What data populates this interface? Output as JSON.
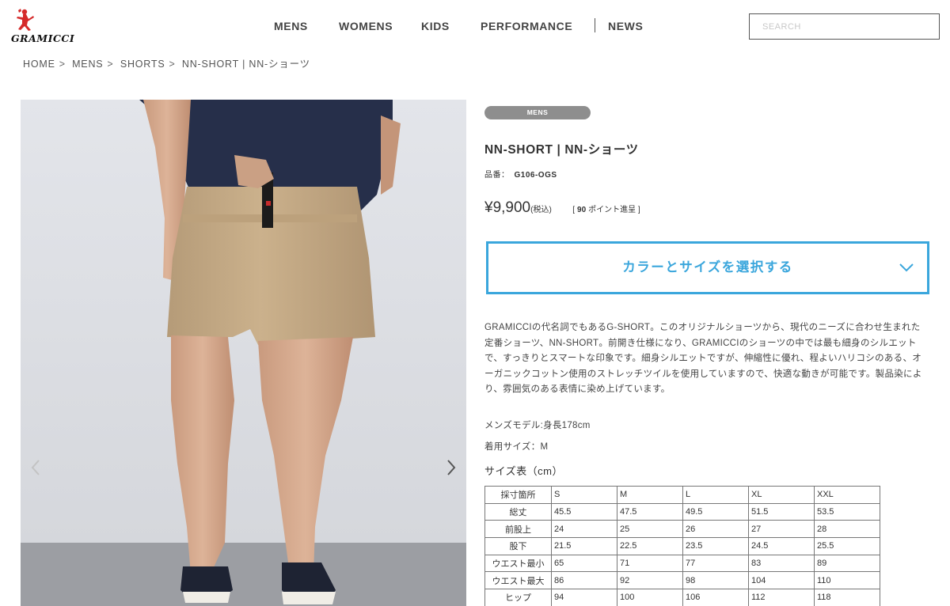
{
  "brand": {
    "logo_text": "GRAMICCI",
    "logo_color": "#d52a2a"
  },
  "nav": {
    "items": [
      "MENS",
      "WOMENS",
      "KIDS",
      "PERFORMANCE",
      "NEWS"
    ]
  },
  "search": {
    "placeholder": "SEARCH"
  },
  "breadcrumb": [
    "HOME",
    "MENS",
    "SHORTS",
    "NN-SHORT | NN-ショーツ"
  ],
  "product": {
    "category_badge": "MENS",
    "title": "NN-SHORT | NN-ショーツ",
    "sku_label": "品番：",
    "sku": "G106-OGS",
    "price": "¥9,900",
    "tax_label": "(税込)",
    "points_prefix": "[",
    "points": "90",
    "points_suffix": "ポイント進呈 ]",
    "select_button": "カラーとサイズを選択する",
    "accent_color": "#3aa6dc",
    "description": "GRAMICCIの代名詞でもあるG-SHORT。このオリジナルショーツから、現代のニーズに合わせ生まれた定番ショーツ、NN-SHORT。前開き仕様になり、GRAMICCIのショーツの中では最も細身のシルエットで、すっきりとスマートな印象です。細身シルエットですが、伸縮性に優れ、程よいハリコシのある、オーガニックコットン使用のストレッチツイルを使用していますので、快適な動きが可能です。製品染により、雰囲気のある表情に染め上げています。",
    "model_info": "メンズモデル:身長178cm",
    "worn_size": "着用サイズ：M",
    "size_table_title": "サイズ表（cm）"
  },
  "size_table": {
    "header": [
      "採寸箇所",
      "S",
      "M",
      "L",
      "XL",
      "XXL"
    ],
    "rows": [
      [
        "総丈",
        "45.5",
        "47.5",
        "49.5",
        "51.5",
        "53.5"
      ],
      [
        "前股上",
        "24",
        "25",
        "26",
        "27",
        "28"
      ],
      [
        "股下",
        "21.5",
        "22.5",
        "23.5",
        "24.5",
        "25.5"
      ],
      [
        "ウエスト最小",
        "65",
        "71",
        "77",
        "83",
        "89"
      ],
      [
        "ウエスト最大",
        "86",
        "92",
        "98",
        "104",
        "110"
      ],
      [
        "ヒップ",
        "94",
        "100",
        "106",
        "112",
        "118"
      ]
    ]
  },
  "gallery": {
    "prev_icon": "chevron-left-icon",
    "next_icon": "chevron-right-icon"
  }
}
